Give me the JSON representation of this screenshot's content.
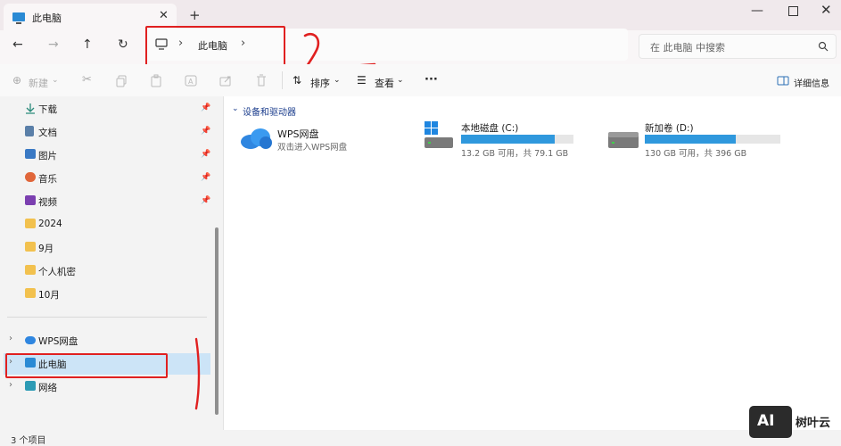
{
  "window": {
    "tab_title": "此电脑",
    "close_glyph": "✕",
    "new_tab_glyph": "+",
    "minimize_glyph": "—",
    "close_window_glyph": "✕"
  },
  "nav": {
    "back": "←",
    "forward": "→",
    "up": "↑",
    "refresh": "↻",
    "breadcrumb": [
      "此电脑"
    ],
    "breadcrumb_sep": "›"
  },
  "search": {
    "placeholder": "在 此电脑 中搜索"
  },
  "toolbar": {
    "new_label": "新建",
    "sort_label": "排序",
    "view_label": "查看",
    "more_label": "···",
    "details_label": "详细信息"
  },
  "sidebar": {
    "quick_access": [
      {
        "label": "下载",
        "icon": "download-icon",
        "pinned": true
      },
      {
        "label": "文档",
        "icon": "document-icon",
        "pinned": true
      },
      {
        "label": "图片",
        "icon": "pictures-icon",
        "pinned": true
      },
      {
        "label": "音乐",
        "icon": "music-icon",
        "pinned": true
      },
      {
        "label": "视频",
        "icon": "video-icon",
        "pinned": true
      },
      {
        "label": "2024",
        "icon": "folder-icon",
        "pinned": false
      },
      {
        "label": "9月",
        "icon": "folder-icon",
        "pinned": false
      },
      {
        "label": "个人机密",
        "icon": "folder-icon",
        "pinned": false
      },
      {
        "label": "10月",
        "icon": "folder-icon",
        "pinned": false
      }
    ],
    "locations": [
      {
        "label": "WPS网盘",
        "icon": "cloud-icon"
      },
      {
        "label": "此电脑",
        "icon": "computer-icon",
        "selected": true
      },
      {
        "label": "网络",
        "icon": "network-icon"
      }
    ]
  },
  "main": {
    "group_title": "设备和驱动器",
    "wps": {
      "title": "WPS网盘",
      "subtitle": "双击进入WPS网盘"
    },
    "drives": [
      {
        "name": "本地磁盘 (C:)",
        "info": "13.2 GB 可用，共 79.1 GB",
        "used_fraction": 0.833
      },
      {
        "name": "新加卷 (D:)",
        "info": "130 GB 可用，共 396 GB",
        "used_fraction": 0.672
      }
    ]
  },
  "status": {
    "item_count": "3 个项目"
  },
  "watermark": {
    "badge": "AI",
    "text": "树叶云"
  },
  "colors": {
    "accent": "#2f98dd",
    "highlight": "#e02020",
    "selection": "#cce4f7"
  }
}
